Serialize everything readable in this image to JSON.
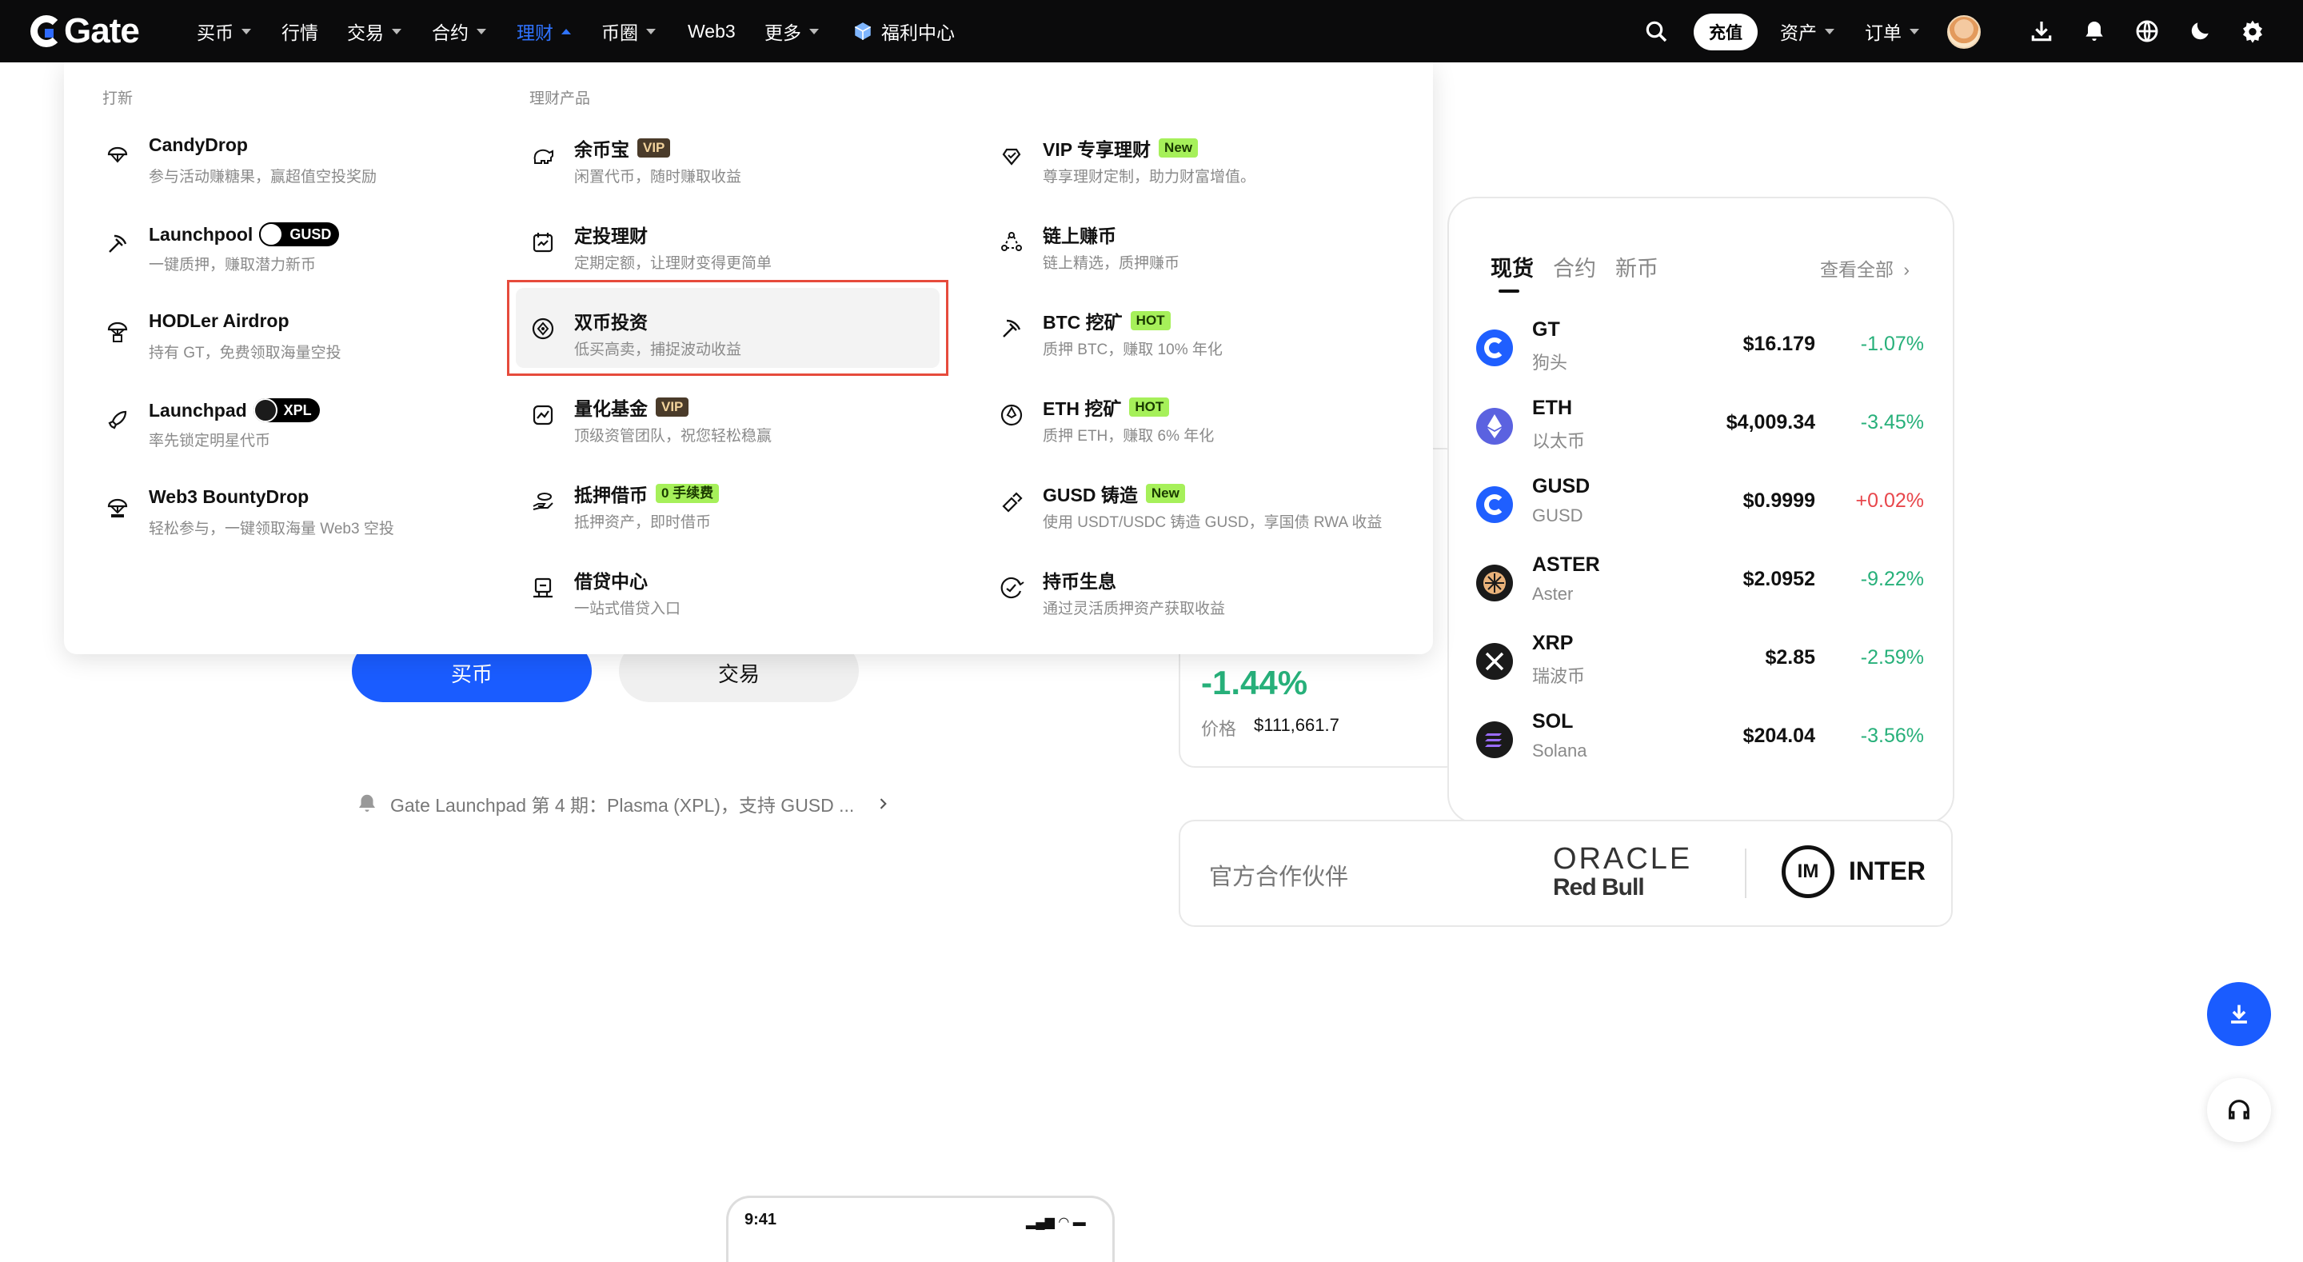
{
  "nav": {
    "logo": "Gate",
    "items": [
      {
        "label": "买币",
        "caret": true
      },
      {
        "label": "行情",
        "caret": false
      },
      {
        "label": "交易",
        "caret": true
      },
      {
        "label": "合约",
        "caret": true
      },
      {
        "label": "理财",
        "caret": true,
        "active": true
      },
      {
        "label": "币圈",
        "caret": true
      },
      {
        "label": "Web3",
        "caret": false
      },
      {
        "label": "更多",
        "caret": true
      },
      {
        "label": "福利中心",
        "caret": false
      }
    ],
    "deposit": "充值",
    "assets": "资产",
    "orders": "订单",
    "icons": [
      "search-icon",
      "download-icon",
      "bell-icon",
      "globe-icon",
      "moon-icon",
      "gear-icon"
    ]
  },
  "dropdown": {
    "section_left": "打新",
    "section_right": "理财产品",
    "left_items": [
      {
        "title": "CandyDrop",
        "desc": "参与活动赚糖果，赢超值空投奖励",
        "icon": "candydrop-icon"
      },
      {
        "title": "Launchpool",
        "chip": "GUSD",
        "desc": "一键质押，赚取潜力新币",
        "icon": "launchpool-icon"
      },
      {
        "title": "HODLer Airdrop",
        "desc": "持有 GT，免费领取海量空投",
        "icon": "airdrop-icon"
      },
      {
        "title": "Launchpad",
        "chip": "XPL",
        "desc": "率先锁定明星代币",
        "icon": "rocket-icon"
      },
      {
        "title": "Web3 BountyDrop",
        "desc": "轻松参与，一键领取海量 Web3 空投",
        "icon": "web3-icon"
      }
    ],
    "mid_items": [
      {
        "title": "余币宝",
        "badge": "VIP",
        "badge_type": "vip",
        "desc": "闲置代币，随时赚取收益",
        "icon": "piggy-icon"
      },
      {
        "title": "定投理财",
        "desc": "定期定额，让理财变得更简单",
        "icon": "calendar-icon"
      },
      {
        "title": "双币投资",
        "desc": "低买高卖，捕捉波动收益",
        "icon": "dual-currency-icon"
      },
      {
        "title": "量化基金",
        "badge": "VIP",
        "badge_type": "vip",
        "desc": "顶级资管团队，祝您轻松稳赢",
        "icon": "quant-icon"
      },
      {
        "title": "抵押借币",
        "badge": "0 手续费",
        "badge_type": "new",
        "desc": "抵押资产，即时借币",
        "icon": "collateral-icon"
      },
      {
        "title": "借贷中心",
        "desc": "一站式借贷入口",
        "icon": "loan-icon"
      }
    ],
    "right_items": [
      {
        "title": "VIP 专享理财",
        "badge": "New",
        "badge_type": "new",
        "desc": "尊享理财定制，助力财富增值。",
        "icon": "vip-icon"
      },
      {
        "title": "链上赚币",
        "desc": "链上精选，质押赚币",
        "icon": "onchain-icon"
      },
      {
        "title": "BTC 挖矿",
        "badge": "HOT",
        "badge_type": "hot",
        "desc": "质押 BTC，赚取 10% 年化",
        "icon": "pickaxe-icon"
      },
      {
        "title": "ETH 挖矿",
        "badge": "HOT",
        "badge_type": "hot",
        "desc": "质押 ETH，赚取 6% 年化",
        "icon": "eth-mining-icon"
      },
      {
        "title": "GUSD 铸造",
        "badge": "New",
        "badge_type": "new",
        "desc": "使用 USDT/USDC 铸造 GUSD，享国债 RWA 收益",
        "icon": "mint-icon"
      },
      {
        "title": "持币生息",
        "desc": "通过灵活质押资产获取收益",
        "icon": "interest-icon"
      }
    ]
  },
  "market": {
    "tabs": [
      "现货",
      "合约",
      "新币"
    ],
    "view_all": "查看全部",
    "rows": [
      {
        "sym": "GT",
        "name": "狗头",
        "price": "$16.179",
        "change": "-1.07%",
        "dir": "down",
        "color": "#1f5fff"
      },
      {
        "sym": "ETH",
        "name": "以太币",
        "price": "$4,009.34",
        "change": "-3.45%",
        "dir": "down",
        "color": "#5b62e0"
      },
      {
        "sym": "GUSD",
        "name": "GUSD",
        "price": "$0.9999",
        "change": "+0.02%",
        "dir": "up",
        "color": "#1f5fff"
      },
      {
        "sym": "ASTER",
        "name": "Aster",
        "price": "$2.0952",
        "change": "-9.22%",
        "dir": "down",
        "color": "#1a1a1a"
      },
      {
        "sym": "XRP",
        "name": "瑞波币",
        "price": "$2.85",
        "change": "-2.59%",
        "dir": "down",
        "color": "#1a1a1a"
      },
      {
        "sym": "SOL",
        "name": "Solana",
        "price": "$204.04",
        "change": "-3.56%",
        "dir": "down",
        "color": "#1a1a1a"
      }
    ]
  },
  "btc_card": {
    "change": "-1.44%",
    "price_label": "价格",
    "price": "$111,661.7"
  },
  "hero": {
    "buy": "买币",
    "trade": "交易",
    "notice": "Gate Launchpad 第 4 期：Plasma (XPL)，支持 GUSD ..."
  },
  "partners": {
    "label": "官方合作伙伴",
    "oracle": "ORACLE",
    "redbull": "Red Bull",
    "inter": "INTER"
  },
  "phone": {
    "time": "9:41"
  }
}
